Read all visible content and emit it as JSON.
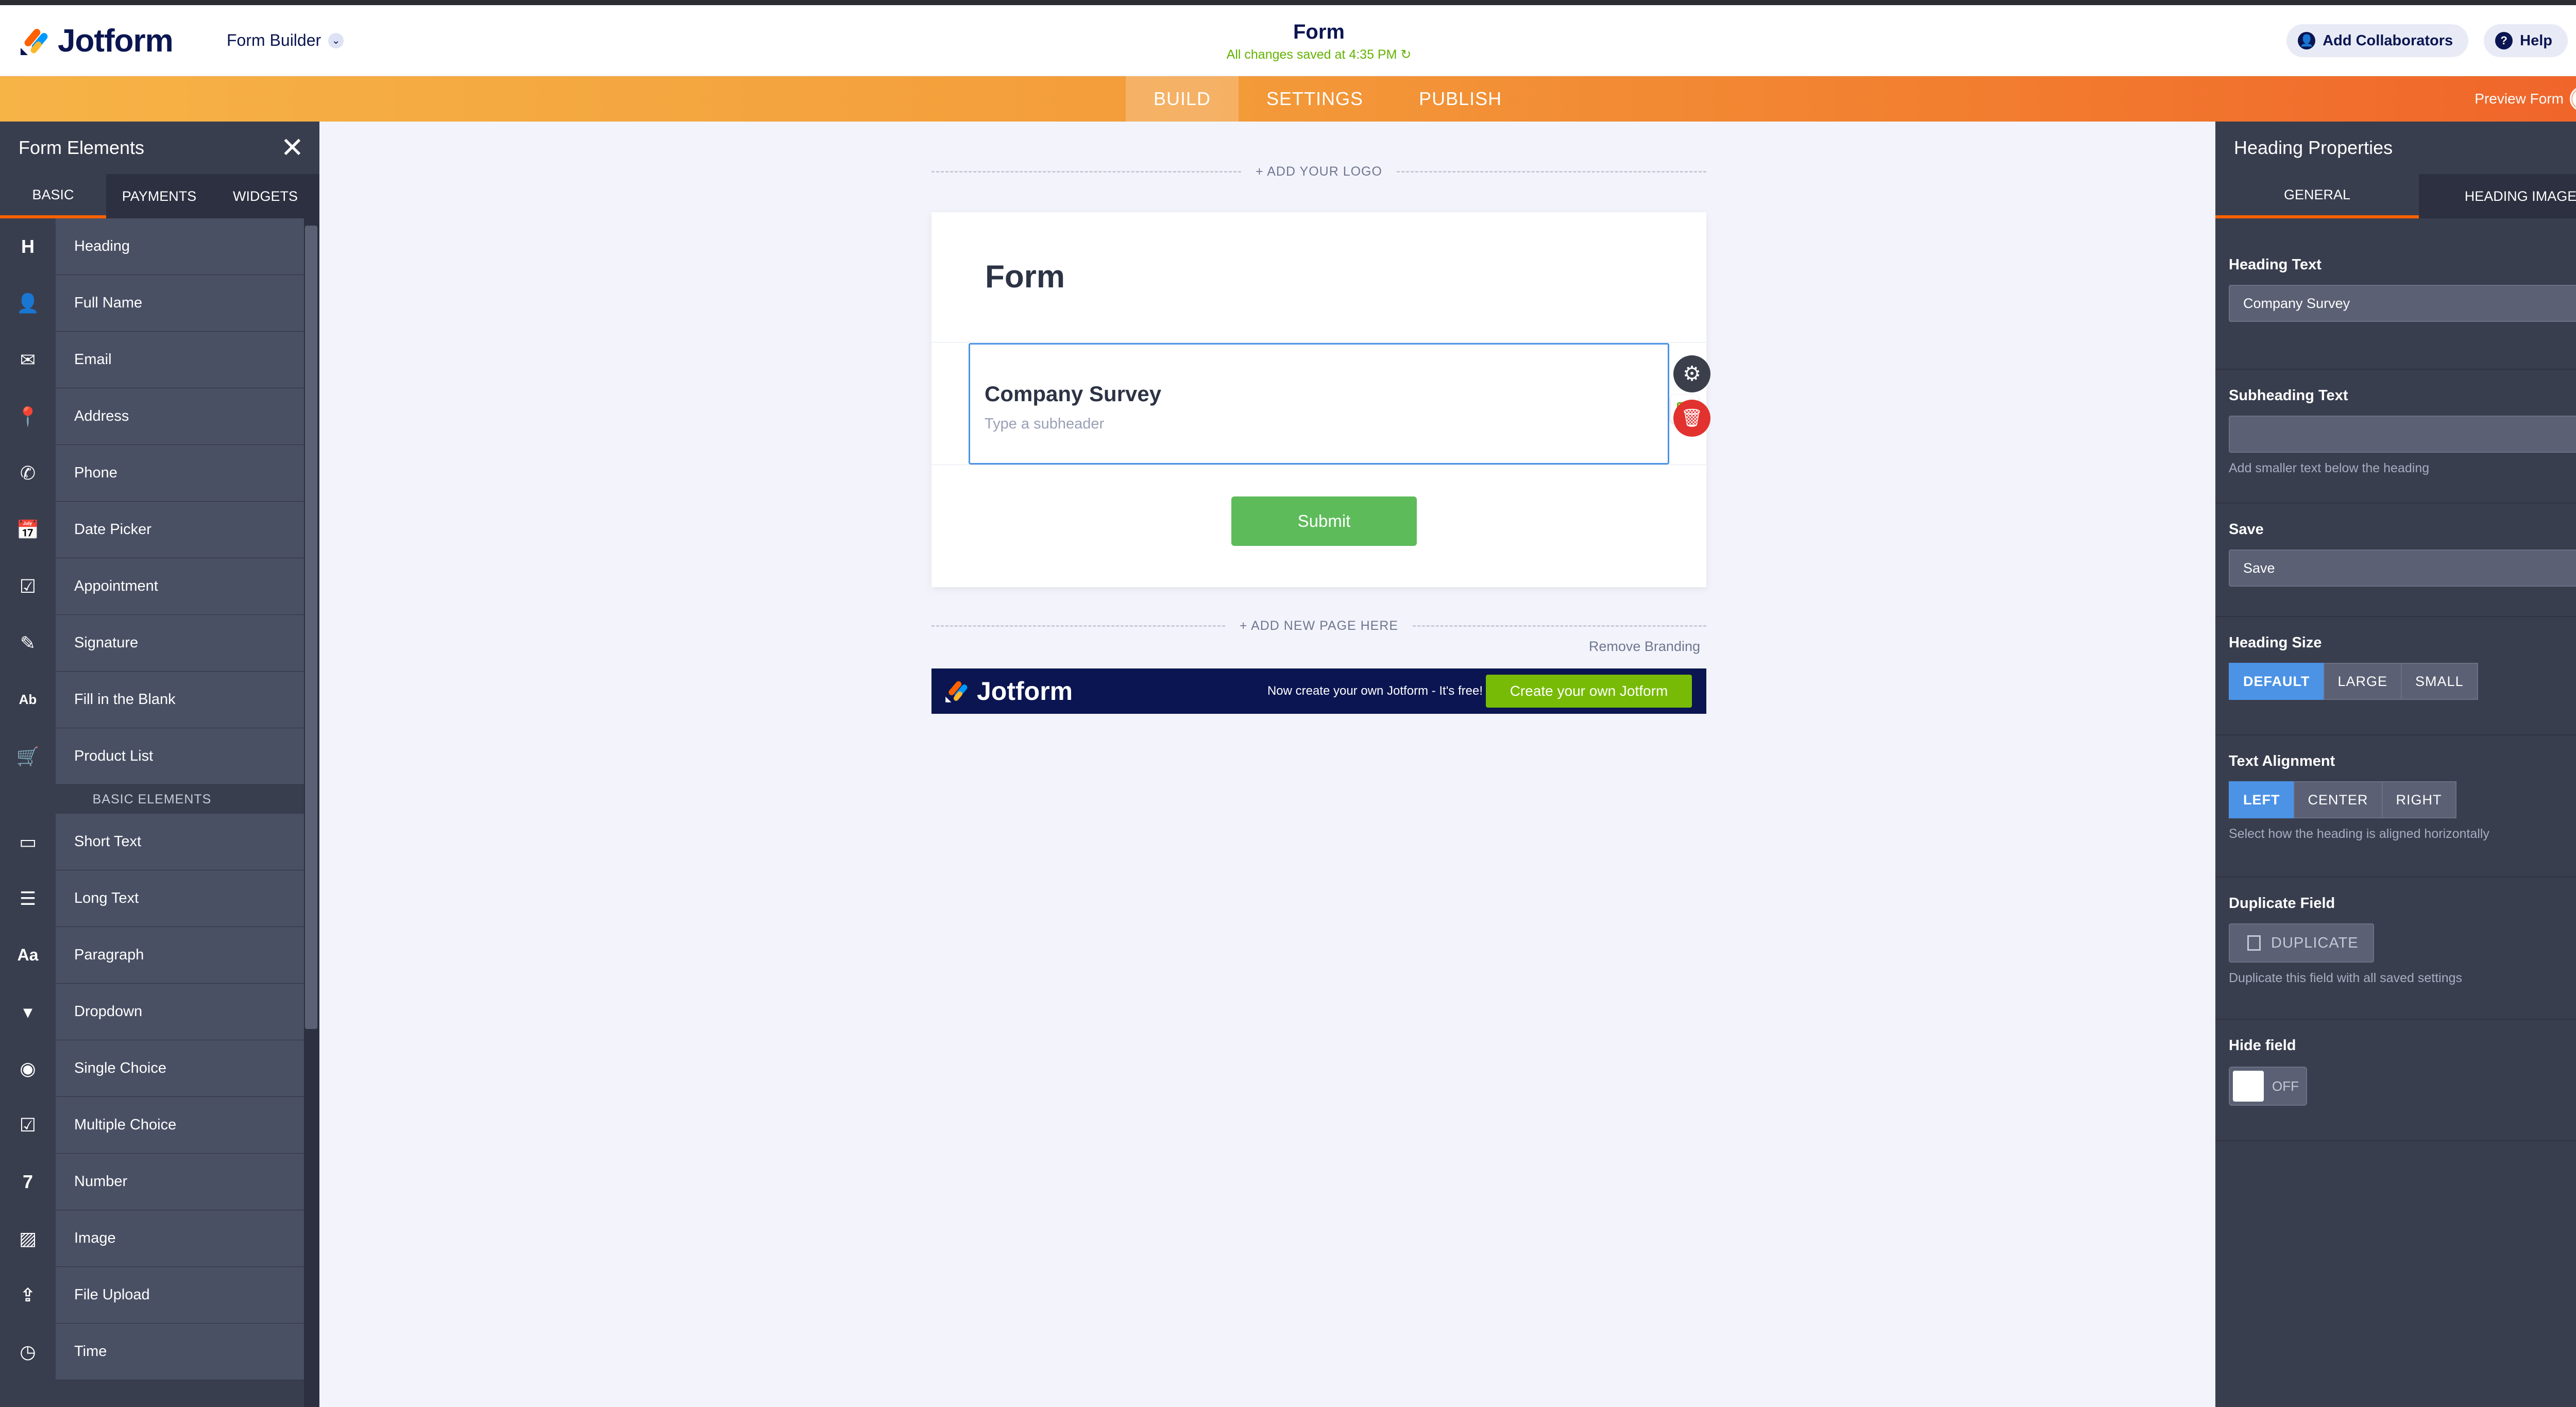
{
  "header": {
    "logo_text": "Jotform",
    "form_builder_label": "Form Builder",
    "form_title": "Form",
    "saved_status": "All changes saved at 4:35 PM",
    "add_collaborators_label": "Add Collaborators",
    "help_label": "Help"
  },
  "nav": {
    "tabs": [
      {
        "label": "BUILD"
      },
      {
        "label": "SETTINGS"
      },
      {
        "label": "PUBLISH"
      }
    ],
    "active_tab": "BUILD",
    "preview_label": "Preview Form",
    "preview_on": false
  },
  "left_panel": {
    "title": "Form Elements",
    "tabs": [
      {
        "label": "BASIC"
      },
      {
        "label": "PAYMENTS"
      },
      {
        "label": "WIDGETS"
      }
    ],
    "items": [
      {
        "label": "Heading",
        "icon": "H"
      },
      {
        "label": "Full Name",
        "icon": "👤"
      },
      {
        "label": "Email",
        "icon": "✉"
      },
      {
        "label": "Address",
        "icon": "📍"
      },
      {
        "label": "Phone",
        "icon": "✆"
      },
      {
        "label": "Date Picker",
        "icon": "📅"
      },
      {
        "label": "Appointment",
        "icon": "☑"
      },
      {
        "label": "Signature",
        "icon": "✎"
      },
      {
        "label": "Fill in the Blank",
        "icon": "Ab"
      },
      {
        "label": "Product List",
        "icon": "🛒"
      }
    ],
    "section_label": "BASIC ELEMENTS",
    "items2": [
      {
        "label": "Short Text",
        "icon": "▭"
      },
      {
        "label": "Long Text",
        "icon": "☰"
      },
      {
        "label": "Paragraph",
        "icon": "Aa"
      },
      {
        "label": "Dropdown",
        "icon": "▾"
      },
      {
        "label": "Single Choice",
        "icon": "◉"
      },
      {
        "label": "Multiple Choice",
        "icon": "☑"
      },
      {
        "label": "Number",
        "icon": "7"
      },
      {
        "label": "Image",
        "icon": "▨"
      },
      {
        "label": "File Upload",
        "icon": "⇪"
      },
      {
        "label": "Time",
        "icon": "◷"
      }
    ]
  },
  "canvas": {
    "add_logo_label": "+ ADD YOUR LOGO",
    "form_heading": "Form",
    "heading_field": {
      "title": "Company Survey",
      "subheader_placeholder": "Type a subheader"
    },
    "submit_label": "Submit",
    "add_page_label": "+ ADD NEW PAGE HERE",
    "remove_branding_label": "Remove Branding",
    "branding": {
      "logo_text": "Jotform",
      "text": "Now create your own Jotform - It's free!",
      "button_label": "Create your own Jotform"
    }
  },
  "right_panel": {
    "title": "Heading Properties",
    "tabs": [
      {
        "label": "GENERAL"
      },
      {
        "label": "HEADING IMAGE"
      }
    ],
    "heading_text": {
      "label": "Heading Text",
      "value": "Company Survey"
    },
    "subheading_text": {
      "label": "Subheading Text",
      "value": "",
      "help": "Add smaller text below the heading"
    },
    "save": {
      "label": "Save",
      "value": "Save"
    },
    "heading_size": {
      "label": "Heading Size",
      "options": [
        "DEFAULT",
        "LARGE",
        "SMALL"
      ],
      "selected": "DEFAULT"
    },
    "text_alignment": {
      "label": "Text Alignment",
      "options": [
        "LEFT",
        "CENTER",
        "RIGHT"
      ],
      "selected": "LEFT",
      "help": "Select how the heading is aligned horizontally"
    },
    "duplicate_field": {
      "label": "Duplicate Field",
      "button_label": "DUPLICATE",
      "help": "Duplicate this field with all saved settings"
    },
    "hide_field": {
      "label": "Hide field",
      "toggle_label": "OFF",
      "value": false
    }
  },
  "colors": {
    "brand_orange": "#ff6100",
    "brand_navy": "#0a1551",
    "panel_bg": "#393e4e",
    "active_blue": "#4c93e6",
    "submit_green": "#5dbb5a",
    "saved_green": "#64b200",
    "delete_red": "#e2322f"
  }
}
